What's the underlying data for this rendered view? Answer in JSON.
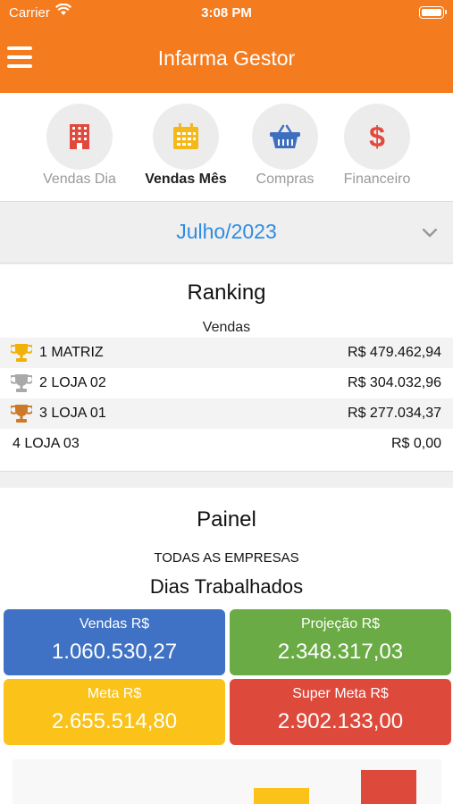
{
  "status_bar": {
    "carrier": "Carrier",
    "time": "3:08 PM"
  },
  "header": {
    "title": "Infarma Gestor"
  },
  "tabs": [
    {
      "label": "Vendas Dia",
      "icon": "building-icon",
      "active": false
    },
    {
      "label": "Vendas Mês",
      "icon": "calendar-icon",
      "active": true
    },
    {
      "label": "Compras",
      "icon": "basket-icon",
      "active": false
    },
    {
      "label": "Financeiro",
      "icon": "dollar-icon",
      "active": false
    }
  ],
  "period": {
    "value": "Julho/2023"
  },
  "ranking": {
    "title": "Ranking",
    "subtitle": "Vendas",
    "rows": [
      {
        "name": "1 MATRIZ",
        "amount": "R$ 479.462,94",
        "trophy": "gold"
      },
      {
        "name": "2 LOJA 02",
        "amount": "R$ 304.032,96",
        "trophy": "silver"
      },
      {
        "name": "3 LOJA 01",
        "amount": "R$ 277.034,37",
        "trophy": "bronze"
      },
      {
        "name": "4 LOJA 03",
        "amount": "R$ 0,00",
        "trophy": ""
      }
    ]
  },
  "painel": {
    "title": "Painel",
    "empresa": "TODAS AS EMPRESAS",
    "dias_label": "Dias Trabalhados",
    "cards": [
      {
        "label": "Vendas R$",
        "value": "1.060.530,27",
        "color": "#3f72c4"
      },
      {
        "label": "Projeção R$",
        "value": "2.348.317,03",
        "color": "#6aab45"
      },
      {
        "label": "Meta R$",
        "value": "2.655.514,80",
        "color": "#fbc21a"
      },
      {
        "label": "Super Meta R$",
        "value": "2.902.133,00",
        "color": "#dd4a3b"
      }
    ]
  },
  "colors": {
    "brand_orange": "#f47b1e",
    "accent_blue": "#2f8ce0",
    "trophy_gold": "#f2b10a",
    "trophy_silver": "#a9a9a9",
    "trophy_bronze": "#cc7a2a"
  }
}
